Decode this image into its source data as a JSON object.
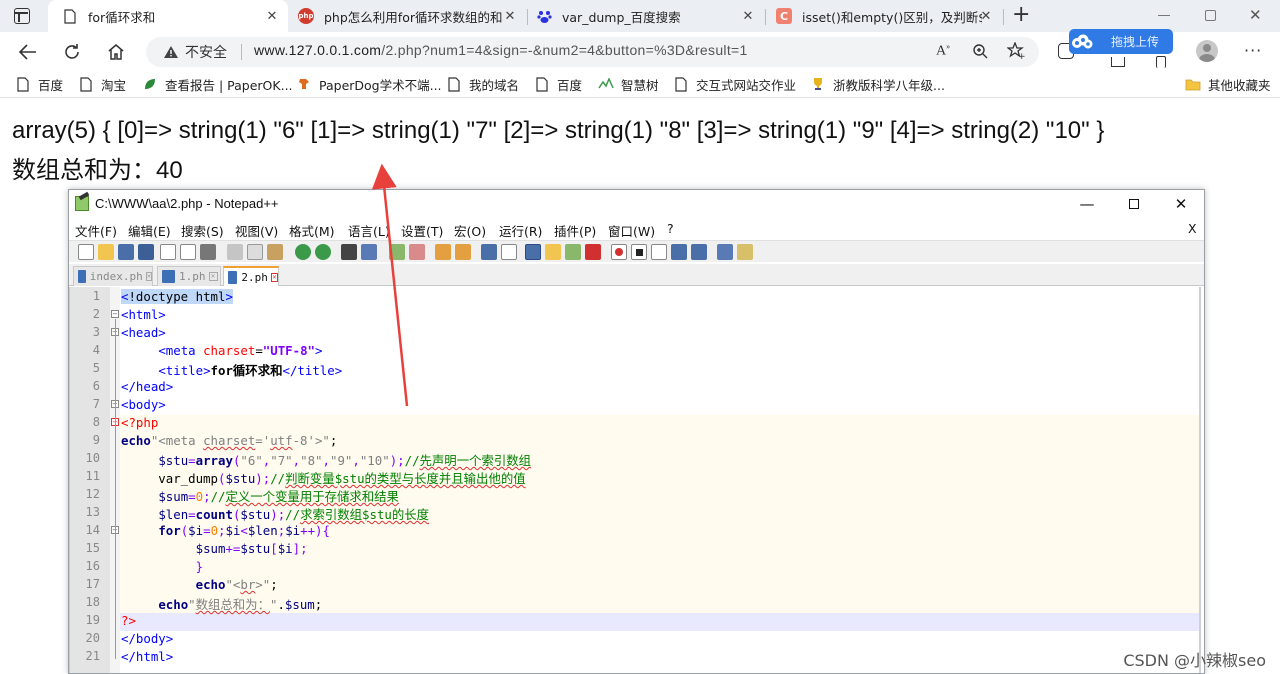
{
  "browser": {
    "tabs": [
      {
        "label": "for循环求和",
        "active": true
      },
      {
        "label": "php怎么利用for循环求数组的和"
      },
      {
        "label": "var_dump_百度搜索"
      },
      {
        "label": "isset()和empty()区别，及判断$_p"
      }
    ],
    "new_tab": "+",
    "security_label": "不安全",
    "url_host": "www.127.0.0.1.com",
    "url_path": "/2.php?num1=4&sign=-&num2=4&button=%3D&result=1",
    "upload_badge": "拖拽上传",
    "bookmarks": [
      {
        "label": "百度"
      },
      {
        "label": "淘宝"
      },
      {
        "label": "查看报告 | PaperOK..."
      },
      {
        "label": "PaperDog学术不端..."
      },
      {
        "label": "我的域名"
      },
      {
        "label": "百度"
      },
      {
        "label": "智慧树"
      },
      {
        "label": "交互式网站交作业"
      },
      {
        "label": "浙教版科学八年级..."
      }
    ],
    "other_bookmarks": "其他收藏夹"
  },
  "page_output": {
    "line1": "array(5) { [0]=> string(1) \"6\" [1]=> string(1) \"7\" [2]=> string(1) \"8\" [3]=> string(1) \"9\" [4]=> string(2) \"10\" }",
    "line2": "数组总和为：40"
  },
  "notepad": {
    "title": "C:\\WWW\\aa\\2.php - Notepad++",
    "menu": [
      "文件(F)",
      "编辑(E)",
      "搜索(S)",
      "视图(V)",
      "格式(M)",
      "语言(L)",
      "设置(T)",
      "宏(O)",
      "运行(R)",
      "插件(P)",
      "窗口(W)",
      "?"
    ],
    "menu_close": "X",
    "file_tabs": [
      {
        "label": "index.ph"
      },
      {
        "label": "1.ph"
      },
      {
        "label": "2.ph",
        "active": true
      }
    ],
    "line_numbers": [
      "1",
      "2",
      "3",
      "4",
      "5",
      "6",
      "7",
      "8",
      "9",
      "10",
      "11",
      "12",
      "13",
      "14",
      "15",
      "16",
      "17",
      "18",
      "19",
      "20",
      "21"
    ]
  },
  "watermark": "CSDN @小辣椒seo",
  "colors": {
    "accent_arrow": "#e8413c",
    "tab_bar": "#ebeef2",
    "upload_blue": "#2f7ae5"
  }
}
